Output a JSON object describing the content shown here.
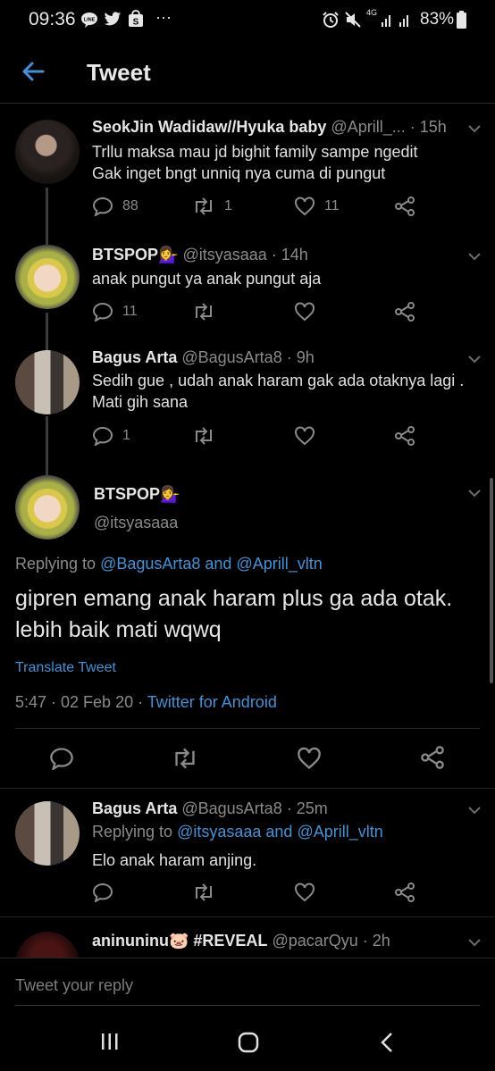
{
  "status": {
    "time": "09:36",
    "battery": "83%",
    "network": "4G",
    "icons": [
      "line-icon",
      "twitter-icon",
      "shopee-icon",
      "more-icon",
      "alarm-icon",
      "mute-icon",
      "signal-icon",
      "battery-icon"
    ]
  },
  "header": {
    "title": "Tweet"
  },
  "tweets": [
    {
      "name": "SeokJin Wadidaw//Hyuka baby",
      "meta": "@Aprill_... · 15h",
      "lines": [
        "Trllu maksa mau jd bighit family sampe ngedit",
        "Gak inget bngt unniq nya cuma di pungut"
      ],
      "replies": "88",
      "retweets": "1",
      "likes": "11"
    },
    {
      "name": "BTSPOP💁‍♀️",
      "meta": "@itsyasaaa · 14h",
      "lines": [
        "anak pungut ya anak pungut aja"
      ],
      "replies": "11",
      "retweets": "",
      "likes": ""
    },
    {
      "name": "Bagus Arta",
      "meta": "@BagusArta8 · 9h",
      "lines": [
        "Sedih gue , udah anak haram gak ada otaknya lagi .",
        "Mati gih sana"
      ],
      "replies": "1",
      "retweets": "",
      "likes": ""
    }
  ],
  "main_tweet": {
    "name": "BTSPOP💁‍♀️",
    "handle": "@itsyasaaa",
    "replying_prefix": "Replying to ",
    "replying_to_1": "@BagusArta8",
    "replying_and": " and ",
    "replying_to_2": "@Aprill_vltn",
    "text": "gipren emang anak haram plus ga ada otak. lebih baik mati wqwq",
    "translate": "Translate Tweet",
    "timestamp": "5:47 · 02 Feb 20 · ",
    "source": "Twitter for Android"
  },
  "reply_tweet": {
    "name": "Bagus Arta",
    "meta": "@BagusArta8 · 25m",
    "replying_prefix": "Replying to ",
    "replying_to_1": "@itsyasaaa",
    "replying_and": " and ",
    "replying_to_2": "@Aprill_vltn",
    "text": "Elo anak haram anjing."
  },
  "partial_tweet": {
    "name": "aninuninu🐷 #REVEAL",
    "meta": "@pacarQyu · 2h"
  },
  "reply_box": {
    "placeholder": "Tweet your reply"
  },
  "colors": {
    "background": "#000000",
    "link": "#3f94d9",
    "muted": "#8a8a8a",
    "accent_icon": "#3f94d9"
  }
}
